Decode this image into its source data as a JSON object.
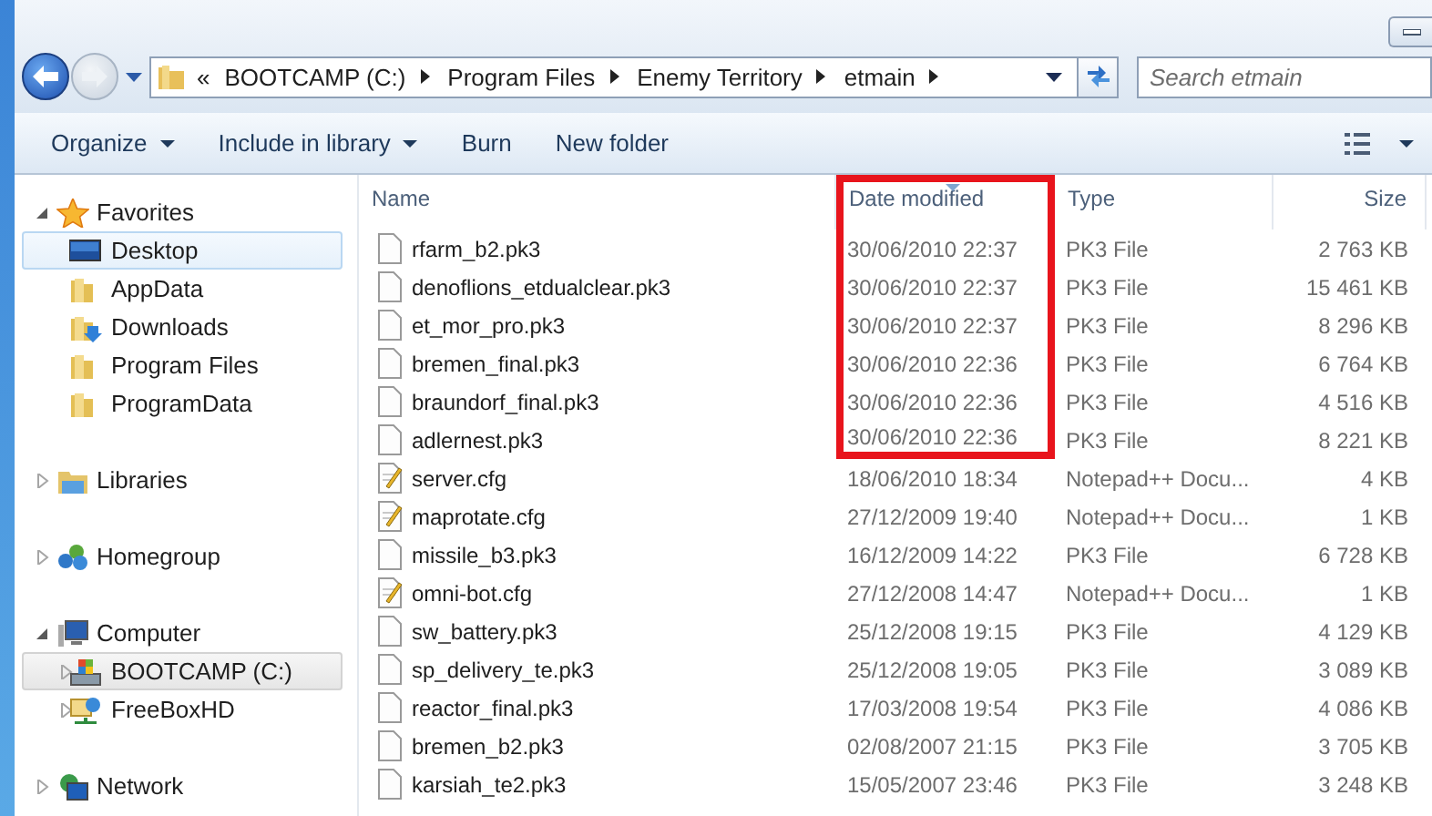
{
  "address": {
    "overflow": "«",
    "crumbs": [
      "BOOTCAMP (C:)",
      "Program Files",
      "Enemy Territory",
      "etmain"
    ]
  },
  "search": {
    "placeholder": "Search etmain"
  },
  "toolbar": [
    {
      "label": "Organize",
      "dropdown": true
    },
    {
      "label": "Include in library",
      "dropdown": true
    },
    {
      "label": "Burn",
      "dropdown": false
    },
    {
      "label": "New folder",
      "dropdown": false
    }
  ],
  "sidebar": {
    "groups": [
      {
        "label": "Favorites",
        "kind": "favorites",
        "expanded": true,
        "children": [
          {
            "label": "Desktop",
            "kind": "desktop",
            "selected": false,
            "hovered": true
          },
          {
            "label": "AppData",
            "kind": "folder",
            "selected": false,
            "hovered": false
          },
          {
            "label": "Downloads",
            "kind": "downloads",
            "selected": false,
            "hovered": false
          },
          {
            "label": "Program Files",
            "kind": "folder",
            "selected": false,
            "hovered": false
          },
          {
            "label": "ProgramData",
            "kind": "folder",
            "selected": false,
            "hovered": false
          }
        ]
      },
      {
        "label": "Libraries",
        "kind": "libraries",
        "expanded": false
      },
      {
        "label": "Homegroup",
        "kind": "homegroup",
        "expanded": false
      },
      {
        "label": "Computer",
        "kind": "computer",
        "expanded": true,
        "children": [
          {
            "label": "BOOTCAMP (C:)",
            "kind": "drive",
            "expanded": false,
            "selected": true,
            "hovered": false
          },
          {
            "label": "FreeBoxHD",
            "kind": "netdrive",
            "expanded": false,
            "selected": false,
            "hovered": false
          }
        ]
      },
      {
        "label": "Network",
        "kind": "network",
        "expanded": false
      }
    ]
  },
  "table": {
    "columns": [
      {
        "label": "Name",
        "sorted": false,
        "highlighted": false
      },
      {
        "label": "Date modified",
        "sorted": true,
        "highlighted": true
      },
      {
        "label": "Type",
        "sorted": false,
        "highlighted": false
      },
      {
        "label": "Size",
        "sorted": false,
        "highlighted": false
      }
    ],
    "rows": [
      {
        "name": "rfarm_b2.pk3",
        "date": "30/06/2010 22:37",
        "type": "PK3 File",
        "size": "2 763 KB",
        "kind": "file",
        "highlighted": true
      },
      {
        "name": "denoflions_etdualclear.pk3",
        "date": "30/06/2010 22:37",
        "type": "PK3 File",
        "size": "15 461 KB",
        "kind": "file",
        "highlighted": true
      },
      {
        "name": "et_mor_pro.pk3",
        "date": "30/06/2010 22:37",
        "type": "PK3 File",
        "size": "8 296 KB",
        "kind": "file",
        "highlighted": true
      },
      {
        "name": "bremen_final.pk3",
        "date": "30/06/2010 22:36",
        "type": "PK3 File",
        "size": "6 764 KB",
        "kind": "file",
        "highlighted": true
      },
      {
        "name": "braundorf_final.pk3",
        "date": "30/06/2010 22:36",
        "type": "PK3 File",
        "size": "4 516 KB",
        "kind": "file",
        "highlighted": true
      },
      {
        "name": "adlernest.pk3",
        "date": "30/06/2010 22:36",
        "type": "PK3 File",
        "size": "8 221 KB",
        "kind": "file",
        "highlighted": true
      },
      {
        "name": "server.cfg",
        "date": "18/06/2010 18:34",
        "type": "Notepad++ Docu...",
        "size": "4 KB",
        "kind": "text",
        "highlighted": false
      },
      {
        "name": "maprotate.cfg",
        "date": "27/12/2009 19:40",
        "type": "Notepad++ Docu...",
        "size": "1 KB",
        "kind": "text",
        "highlighted": false
      },
      {
        "name": "missile_b3.pk3",
        "date": "16/12/2009 14:22",
        "type": "PK3 File",
        "size": "6 728 KB",
        "kind": "file",
        "highlighted": false
      },
      {
        "name": "omni-bot.cfg",
        "date": "27/12/2008 14:47",
        "type": "Notepad++ Docu...",
        "size": "1 KB",
        "kind": "text",
        "highlighted": false
      },
      {
        "name": "sw_battery.pk3",
        "date": "25/12/2008 19:15",
        "type": "PK3 File",
        "size": "4 129 KB",
        "kind": "file",
        "highlighted": false
      },
      {
        "name": "sp_delivery_te.pk3",
        "date": "25/12/2008 19:05",
        "type": "PK3 File",
        "size": "3 089 KB",
        "kind": "file",
        "highlighted": false
      },
      {
        "name": "reactor_final.pk3",
        "date": "17/03/2008 19:54",
        "type": "PK3 File",
        "size": "4 086 KB",
        "kind": "file",
        "highlighted": false
      },
      {
        "name": "bremen_b2.pk3",
        "date": "02/08/2007 21:15",
        "type": "PK3 File",
        "size": "3 705 KB",
        "kind": "file",
        "highlighted": false
      },
      {
        "name": "karsiah_te2.pk3",
        "date": "15/05/2007 23:46",
        "type": "PK3 File",
        "size": "3 248 KB",
        "kind": "file",
        "highlighted": false
      }
    ]
  }
}
